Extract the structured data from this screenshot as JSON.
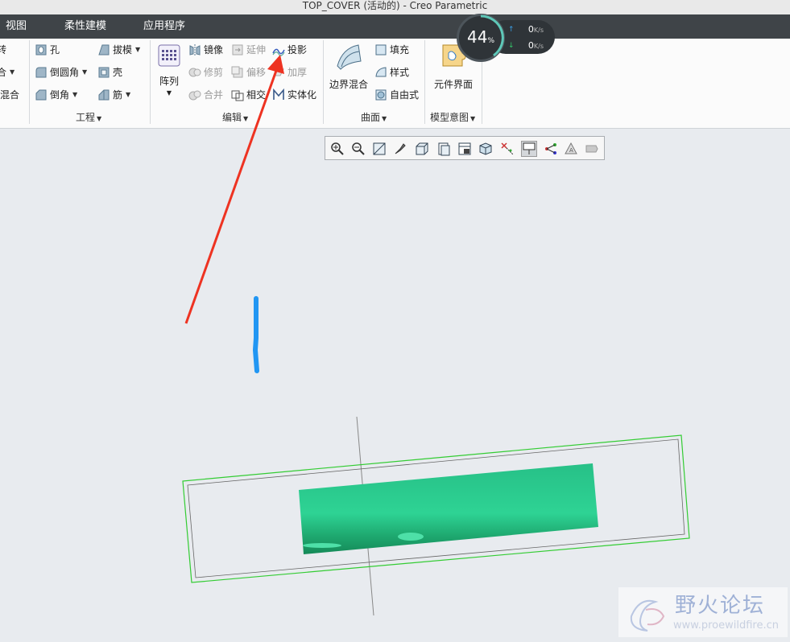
{
  "window": {
    "title": "TOP_COVER (活动的) - Creo Parametric"
  },
  "menubar": {
    "tabs": [
      "视图",
      "柔性建模",
      "应用程序"
    ]
  },
  "ribbon": {
    "left_fragments": [
      "转",
      "合",
      "描混合"
    ],
    "engineering": {
      "hole": "孔",
      "round": "倒圆角",
      "chamfer": "倒角",
      "draft": "拔模",
      "shell": "壳",
      "rib": "筋",
      "label": "工程"
    },
    "edit": {
      "pattern": "阵列",
      "mirror": "镜像",
      "merge": "合并",
      "trim": "修剪",
      "intersect": "相交",
      "extend": "延伸",
      "offset": "偏移",
      "solidify": "实体化",
      "project": "投影",
      "thicken": "加厚",
      "label": "编辑"
    },
    "surfaces": {
      "boundary_blend": "边界混合",
      "fill": "填充",
      "style": "样式",
      "freestyle": "自由式",
      "label": "曲面"
    },
    "model_intent": {
      "component_interface": "元件界面",
      "label": "模型意图"
    }
  },
  "net_monitor": {
    "percent": "44",
    "percent_sign": "%",
    "up": "0",
    "down": "0",
    "unit": "K/s"
  },
  "view_toolbar": {
    "icons": [
      "zoom-in-icon",
      "zoom-out-icon",
      "refit-icon",
      "repaint-icon",
      "display-style-icon",
      "saved-orientations-icon",
      "view-manager-icon",
      "perspective-icon",
      "datum-display-icon",
      "spin-center-icon",
      "note-display-icon",
      "annotation-icon",
      "appearance-icon"
    ]
  },
  "watermark": {
    "title": "野火论坛",
    "url": "www.proewildfire.cn"
  },
  "colors": {
    "model_green": "#2ac584",
    "bbox_green": "#33cc33",
    "annotation_red": "#ee3322",
    "sketch_blue": "#2196f3",
    "menubar_dark": "#3f4448"
  }
}
